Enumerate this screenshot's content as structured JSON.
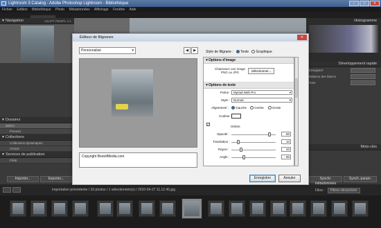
{
  "window": {
    "title": "Lightroom 3 Catalog - Adobe Photoshop Lightroom - Bibliothèque"
  },
  "menu": [
    "Fichier",
    "Edition",
    "Bibliothèque",
    "Photo",
    "Métadonnées",
    "Affichage",
    "Fenêtre",
    "Aide"
  ],
  "left_panel": {
    "navigator": {
      "title": "Navigation",
      "zoom_options": "ADAPT  REMPL  1:1"
    },
    "folders_title": "Dossiers",
    "folders": [
      "DEEO",
      "Pictures"
    ],
    "collections_title": "Collections",
    "collections": [
      "Collections dynamiques",
      "Choisir"
    ],
    "publish_title": "Services de publication",
    "publish_items": [
      "Flickr"
    ],
    "import_button": "Importer...",
    "export_button": "Exporter..."
  },
  "right_panel": {
    "histogram_title": "Histogramme",
    "quick_dev_title": "Développement rapide",
    "quick_dev_rows": [
      "Enregistré",
      "Balance des blancs",
      "Tons"
    ],
    "keywords_title": "Mots-clés",
    "sync_buttons": [
      "Synchr. métadonnées",
      "Synch. param."
    ]
  },
  "statusbar": {
    "path": "Importation précédente / 33 photos / 1 sélectionnée(s) / 2010-04-27 11.12.46.jpg",
    "filter_label": "Filtre :",
    "filter_value": "Filtres désactivés"
  },
  "dialog": {
    "title": "Éditeur de filigranes",
    "preset": "Personnalisé",
    "prev_label": "◀",
    "next_label": "▶",
    "style_label": "Style de filigrane :",
    "style_text": "Texte",
    "style_graphic": "Graphique",
    "watermark_text": "Copyright BestofMedia.com",
    "image_options": {
      "title": "Options d'image",
      "hint_line1": "Chaisissez une image",
      "hint_line2": "PNG ou JPG",
      "choose_button": "Sélectionner..."
    },
    "text_options": {
      "title": "Options de texte",
      "font_label": "Police :",
      "font_value": "Myriad Web Pro",
      "style_label": "Style :",
      "style_value": "Normal",
      "align_label": "Alignement :",
      "align_left": "Gauche",
      "align_center": "Centre",
      "align_right": "Droite",
      "color_label": "Couleur :"
    },
    "shadow": {
      "label": "Ombre",
      "opacity_label": "Opacité :",
      "opacity_value": "80",
      "translation_label": "Translation :",
      "translation_value": "10",
      "radius_label": "Rayon :",
      "radius_value": "20",
      "angle_label": "Angle :",
      "angle_value": "- 90"
    },
    "save_button": "Enregistrer",
    "cancel_button": "Annuler"
  },
  "colors": {
    "titlebar": "#4a6b99",
    "dialog_bg": "#f0f0f0",
    "lightroom_panel": "#3a3a3a"
  }
}
